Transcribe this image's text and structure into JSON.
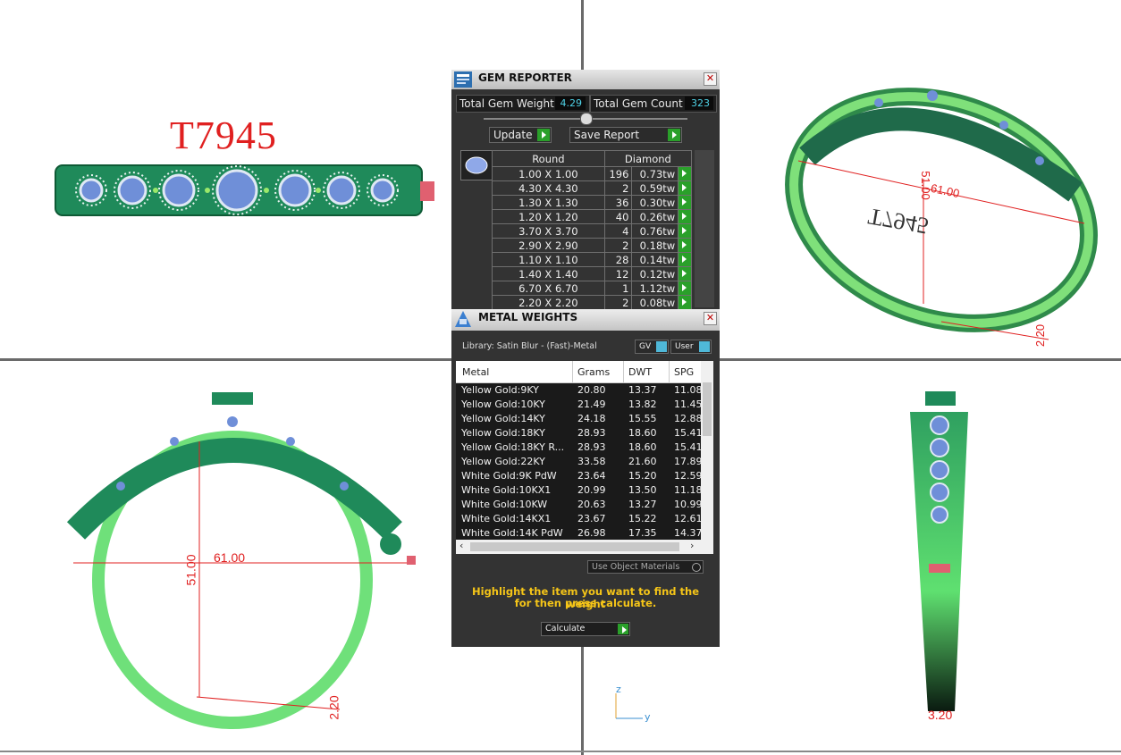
{
  "viewports": {
    "front": {
      "model_label": "T7945"
    },
    "perspective": {
      "dim_diameter": "61.00",
      "dim_height": "51.00",
      "dim_thickness": "2.20",
      "engraving": "T7945"
    },
    "side": {
      "dim_diameter": "61.00",
      "dim_height": "51.00",
      "dim_thickness": "2.20"
    },
    "right": {
      "dim_width": "3.20",
      "axis_z": "z",
      "axis_y": "y"
    }
  },
  "gem_reporter": {
    "title": "GEM REPORTER",
    "close": "✕",
    "total_weight_label": "Total Gem Weight",
    "total_weight_value": "4.29",
    "total_count_label": "Total Gem Count",
    "total_count_value": "323",
    "update_label": "Update",
    "save_report_label": "Save Report",
    "shape_header": "Round",
    "material_header": "Diamond",
    "rows": [
      {
        "size": "1.00 X 1.00",
        "count": "196",
        "weight": "0.73tw"
      },
      {
        "size": "4.30 X 4.30",
        "count": "2",
        "weight": "0.59tw"
      },
      {
        "size": "1.30 X 1.30",
        "count": "36",
        "weight": "0.30tw"
      },
      {
        "size": "1.20 X 1.20",
        "count": "40",
        "weight": "0.26tw"
      },
      {
        "size": "3.70 X 3.70",
        "count": "4",
        "weight": "0.76tw"
      },
      {
        "size": "2.90 X 2.90",
        "count": "2",
        "weight": "0.18tw"
      },
      {
        "size": "1.10 X 1.10",
        "count": "28",
        "weight": "0.14tw"
      },
      {
        "size": "1.40 X 1.40",
        "count": "12",
        "weight": "0.12tw"
      },
      {
        "size": "6.70 X 6.70",
        "count": "1",
        "weight": "1.12tw"
      },
      {
        "size": "2.20 X 2.20",
        "count": "2",
        "weight": "0.08tw"
      }
    ]
  },
  "metal_weights": {
    "title": "METAL WEIGHTS",
    "close": "✕",
    "library_label": "Library: Satin Blur - (Fast)-Metal",
    "gv_label": "GV",
    "user_label": "User",
    "columns": [
      "Metal",
      "Grams",
      "DWT",
      "SPG"
    ],
    "rows": [
      {
        "metal": "Yellow Gold:9KY",
        "grams": "20.80",
        "dwt": "13.37",
        "spg": "11.08"
      },
      {
        "metal": "Yellow Gold:10KY",
        "grams": "21.49",
        "dwt": "13.82",
        "spg": "11.45"
      },
      {
        "metal": "Yellow Gold:14KY",
        "grams": "24.18",
        "dwt": "15.55",
        "spg": "12.88"
      },
      {
        "metal": "Yellow Gold:18KY",
        "grams": "28.93",
        "dwt": "18.60",
        "spg": "15.41"
      },
      {
        "metal": "Yellow Gold:18KY R...",
        "grams": "28.93",
        "dwt": "18.60",
        "spg": "15.41"
      },
      {
        "metal": "Yellow Gold:22KY",
        "grams": "33.58",
        "dwt": "21.60",
        "spg": "17.89"
      },
      {
        "metal": "White Gold:9K PdW",
        "grams": "23.64",
        "dwt": "15.20",
        "spg": "12.59"
      },
      {
        "metal": "White Gold:10KX1",
        "grams": "20.99",
        "dwt": "13.50",
        "spg": "11.18"
      },
      {
        "metal": "White Gold:10KW",
        "grams": "20.63",
        "dwt": "13.27",
        "spg": "10.99"
      },
      {
        "metal": "White Gold:14KX1",
        "grams": "23.67",
        "dwt": "15.22",
        "spg": "12.61"
      },
      {
        "metal": "White Gold:14K PdW",
        "grams": "26.98",
        "dwt": "17.35",
        "spg": "14.37"
      }
    ],
    "use_object_materials_label": "Use Object Materials",
    "hint_line1": "Highlight the item you want to find the weight",
    "hint_line2": "for then press calculate.",
    "calculate_label": "Calculate"
  },
  "colors": {
    "accent_green": "#2aa02a",
    "metal_green": "#1f9a5a",
    "dim_red": "#e02020",
    "value_cyan": "#4fd3e8",
    "hint_yellow": "#f5c518"
  }
}
